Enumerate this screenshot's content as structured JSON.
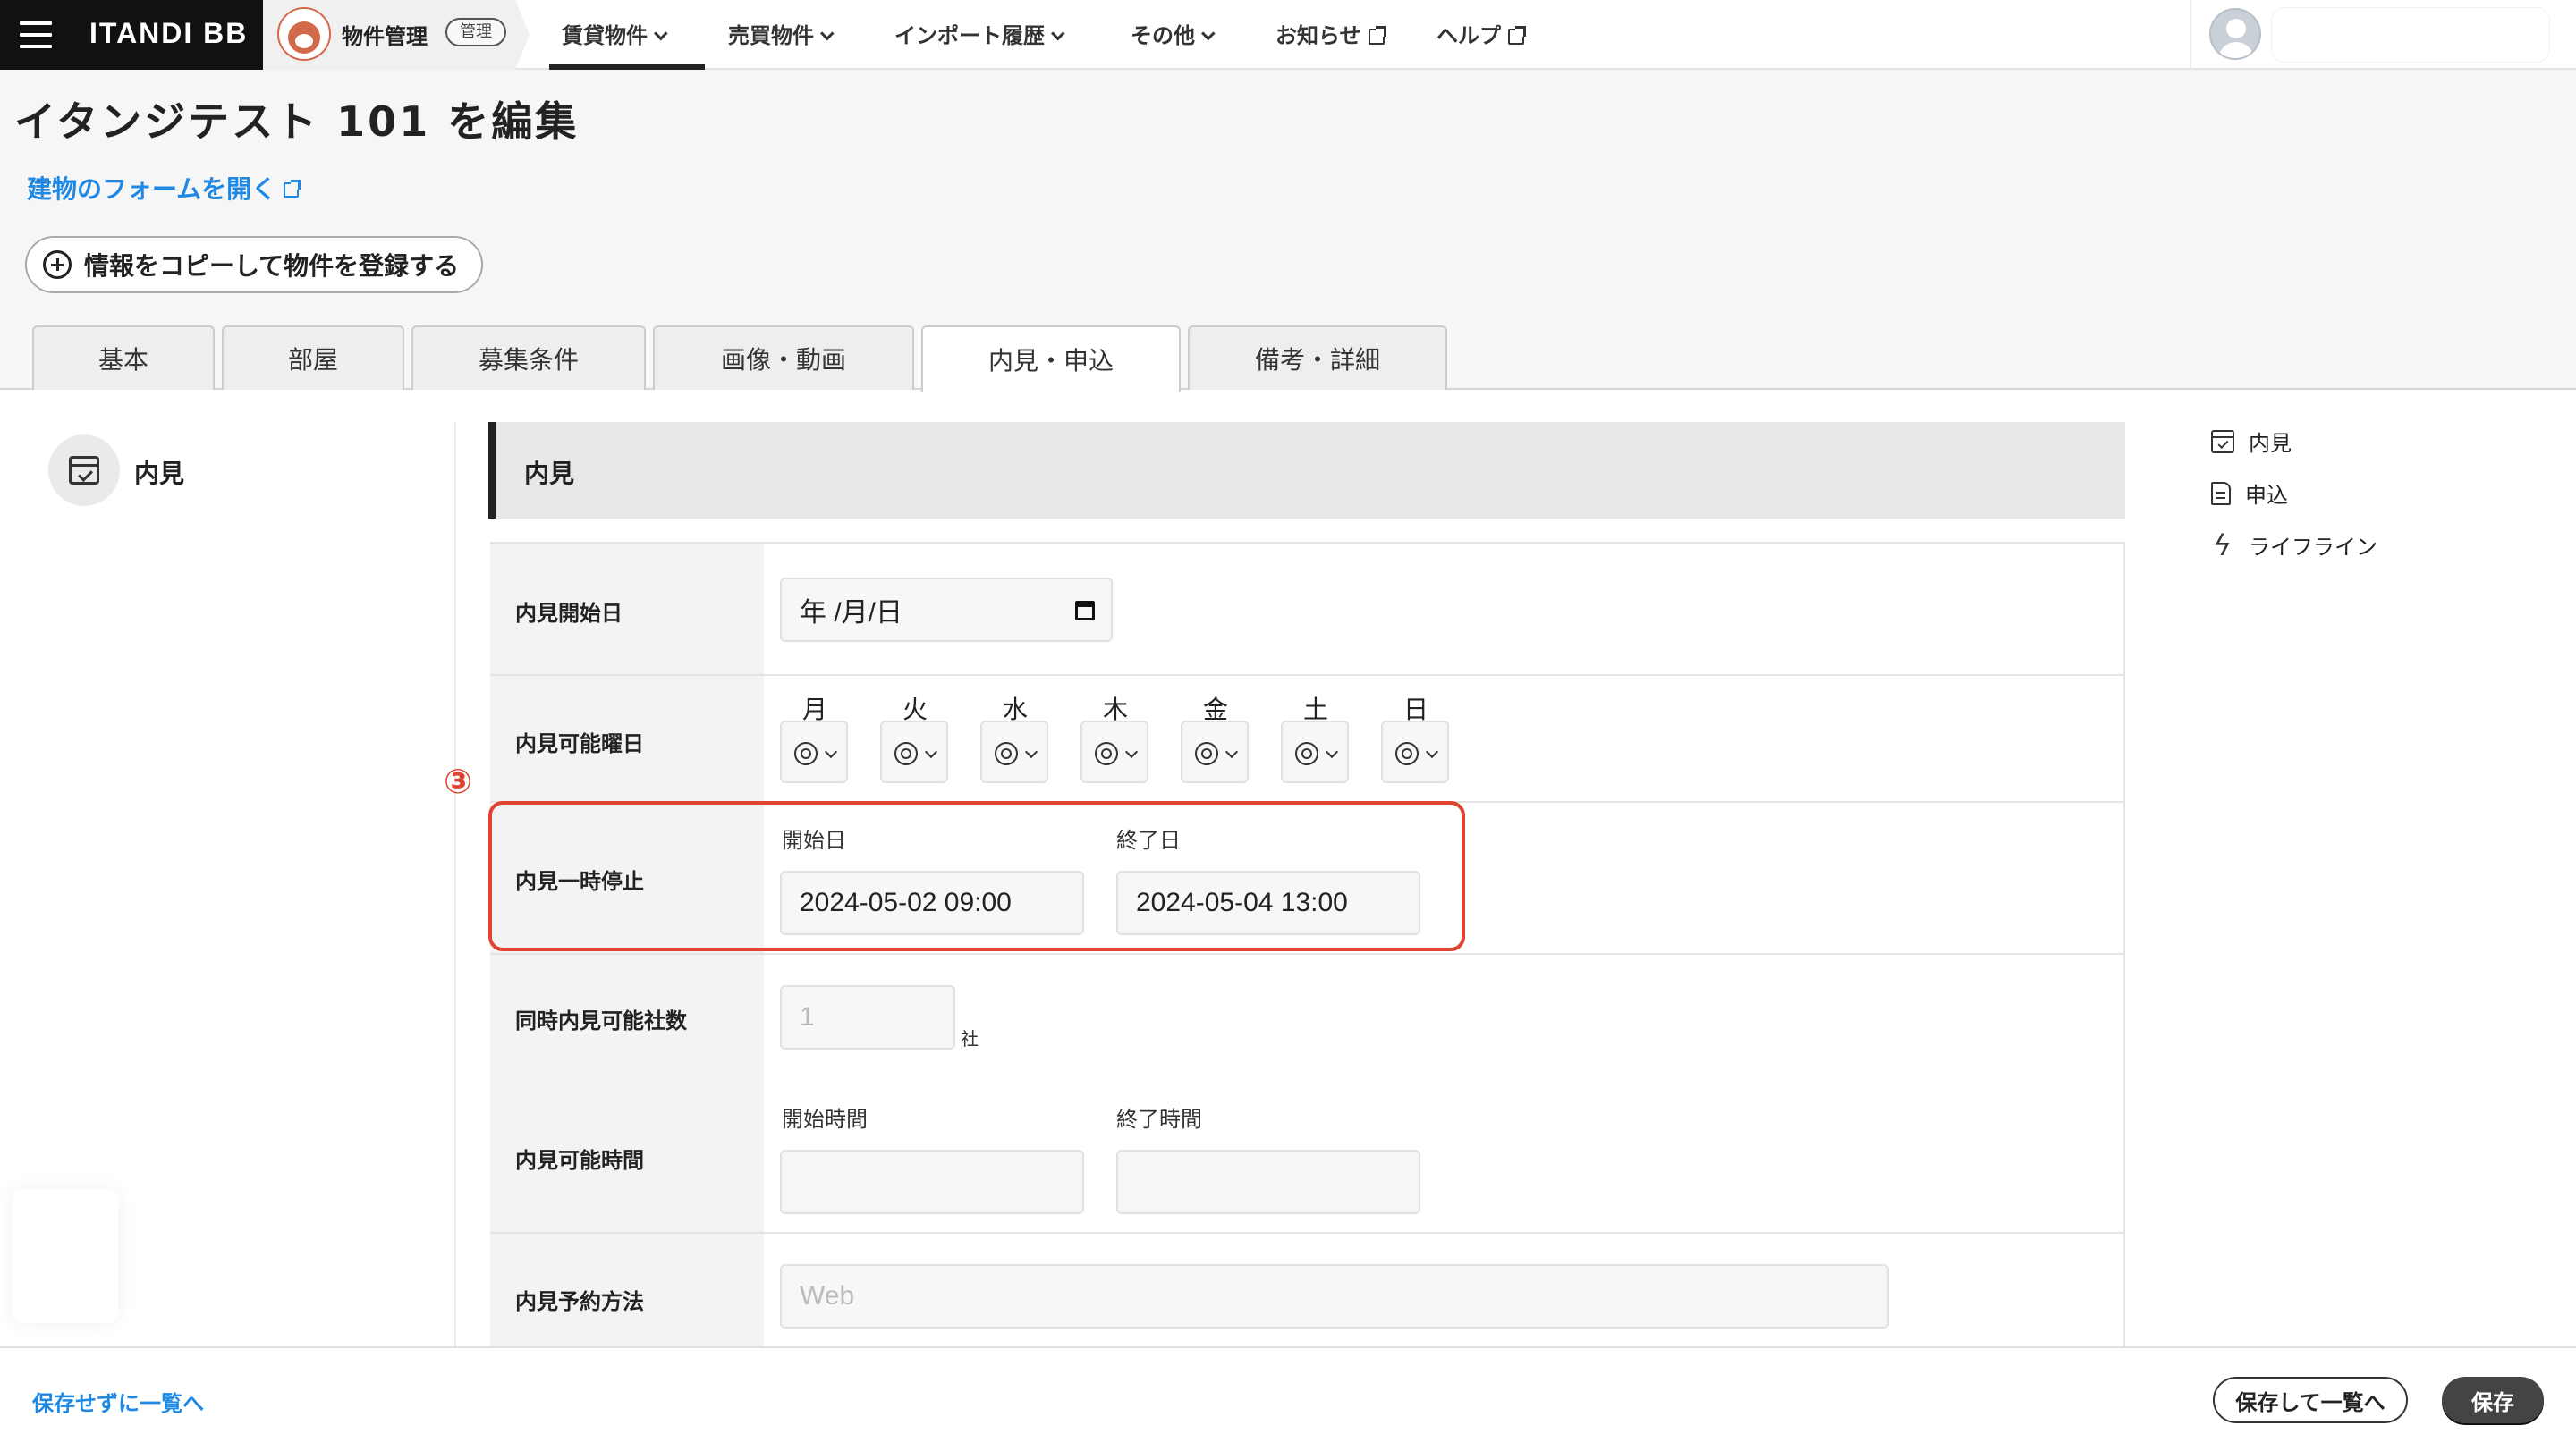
{
  "topbar": {
    "brand": "ITANDI BB",
    "breadcrumb_label": "物件管理",
    "breadcrumb_badge": "管理",
    "nav": [
      {
        "label": "賃貸物件"
      },
      {
        "label": "売買物件"
      },
      {
        "label": "インポート履歴"
      },
      {
        "label": "その他"
      },
      {
        "label": "お知らせ"
      },
      {
        "label": "ヘルプ"
      }
    ]
  },
  "page": {
    "title": "イタンジテスト 101 を編集",
    "building_link": "建物のフォームを開く",
    "copy_button": "情報をコピーして物件を登録する"
  },
  "tabs": [
    {
      "label": "基本"
    },
    {
      "label": "部屋"
    },
    {
      "label": "募集条件"
    },
    {
      "label": "画像・動画"
    },
    {
      "label": "内見・申込",
      "active": true
    },
    {
      "label": "備考・詳細"
    }
  ],
  "section_nav": {
    "label": "内見"
  },
  "form": {
    "section_title": "内見",
    "viewing_start": {
      "label": "内見開始日",
      "value": "年 /月/日"
    },
    "weekdays": {
      "label": "内見可能曜日",
      "days": [
        {
          "day": "月",
          "value": "◎"
        },
        {
          "day": "火",
          "value": "◎"
        },
        {
          "day": "水",
          "value": "◎"
        },
        {
          "day": "木",
          "value": "◎"
        },
        {
          "day": "金",
          "value": "◎"
        },
        {
          "day": "土",
          "value": "◎"
        },
        {
          "day": "日",
          "value": "◎"
        }
      ]
    },
    "suspend": {
      "marker": "③",
      "label": "内見一時停止",
      "start_label": "開始日",
      "start_value": "2024-05-02 09:00",
      "end_label": "終了日",
      "end_value": "2024-05-04 13:00"
    },
    "concurrent": {
      "label": "同時内見可能社数",
      "placeholder": "1",
      "unit": "社"
    },
    "hours": {
      "label": "内見可能時間",
      "start_label": "開始時間",
      "end_label": "終了時間"
    },
    "reservation": {
      "label": "内見予約方法",
      "placeholder": "Web"
    }
  },
  "toc": [
    {
      "label": "内見",
      "icon": "calendar-icon"
    },
    {
      "label": "申込",
      "icon": "document-icon"
    },
    {
      "label": "ライフライン",
      "icon": "bolt-icon"
    }
  ],
  "footer": {
    "back_link": "保存せずに一覧へ",
    "save_and_list": "保存して一覧へ",
    "save": "保存"
  }
}
